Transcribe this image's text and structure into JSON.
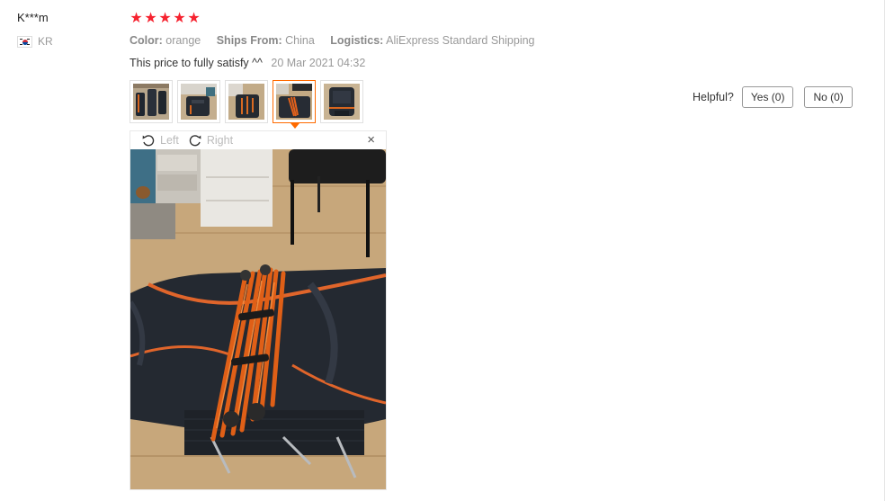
{
  "user": {
    "name": "K***m",
    "country_code": "KR",
    "flag_icon": "south-korea-flag-icon"
  },
  "rating": {
    "stars": 5,
    "max": 5,
    "star_color": "#f6222f"
  },
  "product_meta": {
    "color_label": "Color:",
    "color_value": "orange",
    "ships_label": "Ships From:",
    "ships_value": "China",
    "logistics_label": "Logistics:",
    "logistics_value": "AliExpress Standard Shipping"
  },
  "review": {
    "text": "This price to fully satisfy ^^",
    "date": "20 Mar 2021 04:32"
  },
  "thumbnails": {
    "count": 5,
    "active_index": 3,
    "active_border_color": "#ff6a00"
  },
  "viewer": {
    "rotate_left_label": "Left",
    "rotate_right_label": "Right",
    "close_glyph": "×",
    "rotate_left_icon": "rotate-left-icon",
    "rotate_right_icon": "rotate-right-icon",
    "close_icon": "close-icon"
  },
  "helpful": {
    "label": "Helpful?",
    "yes_label": "Yes (0)",
    "no_label": "No (0)"
  }
}
